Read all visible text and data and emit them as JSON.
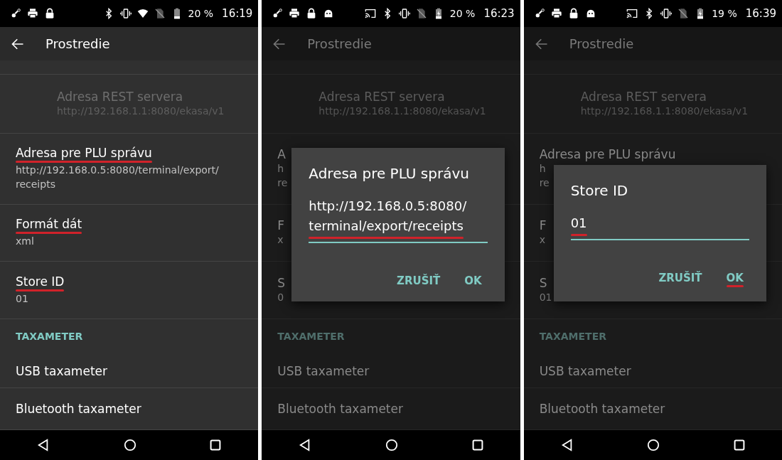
{
  "panels": [
    {
      "status_bar": {
        "left_icons": [
          {
            "kind": "key"
          },
          {
            "kind": "printer"
          },
          {
            "kind": "lock"
          }
        ],
        "right_icons": [
          {
            "kind": "bluetooth"
          },
          {
            "kind": "vibrate"
          },
          {
            "kind": "wifi"
          },
          {
            "kind": "no_sim"
          },
          {
            "kind": "battery"
          }
        ],
        "battery": "20 %",
        "time": "16:19"
      },
      "title": "Prostredie",
      "items": [
        {
          "kind": "pref",
          "title": "Adresa REST servera",
          "summary": [
            "http://192.168.1.1:8080/ekasa/v1"
          ],
          "disabled": true,
          "marked": false
        },
        {
          "kind": "pref",
          "title": "Adresa pre PLU správu",
          "summary": [
            "http://192.168.0.5:8080/terminal/export/",
            "receipts"
          ],
          "disabled": false,
          "marked": true
        },
        {
          "kind": "pref",
          "title": "Formát dát",
          "summary": [
            "xml"
          ],
          "disabled": false,
          "marked": true
        },
        {
          "kind": "pref",
          "title": "Store ID",
          "summary": [
            "01"
          ],
          "disabled": false,
          "marked": true
        },
        {
          "kind": "category",
          "title": "TAXAMETER"
        },
        {
          "kind": "pref",
          "title": "USB taxameter",
          "disabled": false,
          "marked": false
        },
        {
          "kind": "pref",
          "title": "Bluetooth taxameter",
          "disabled": false,
          "marked": false
        }
      ]
    },
    {
      "status_bar": {
        "left_icons": [
          {
            "kind": "key"
          },
          {
            "kind": "printer"
          },
          {
            "kind": "lock"
          },
          {
            "kind": "android"
          }
        ],
        "right_icons": [
          {
            "kind": "cast"
          },
          {
            "kind": "bluetooth"
          },
          {
            "kind": "vibrate"
          },
          {
            "kind": "no_sim"
          },
          {
            "kind": "charging"
          }
        ],
        "battery": "20 %",
        "time": "16:23"
      },
      "title": "Prostredie",
      "items": [
        {
          "kind": "pref",
          "title": "Adresa REST servera",
          "summary": [
            "http://192.168.1.1:8080/ekasa/v1"
          ],
          "disabled": true,
          "marked": false
        },
        {
          "kind": "pref",
          "title": "A",
          "summary": [
            "h",
            "re"
          ],
          "disabled": false,
          "marked": false
        },
        {
          "kind": "pref",
          "title": "F",
          "summary": [
            "x"
          ],
          "disabled": false,
          "marked": false
        },
        {
          "kind": "pref",
          "title": "S",
          "summary": [
            "0"
          ],
          "disabled": false,
          "marked": false
        },
        {
          "kind": "category",
          "title": "TAXAMETER"
        },
        {
          "kind": "pref",
          "title": "USB taxameter",
          "disabled": false,
          "marked": false
        },
        {
          "kind": "pref",
          "title": "Bluetooth taxameter",
          "disabled": false,
          "marked": false
        }
      ],
      "dialog": {
        "title": "Adresa pre PLU správu",
        "value_lines": [
          "http://192.168.0.5:8080/",
          "terminal/export/receipts"
        ],
        "value_marked": true,
        "buttons": [
          {
            "label": "ZRUŠIŤ",
            "marked": false
          },
          {
            "label": "OK",
            "marked": false
          }
        ]
      }
    },
    {
      "status_bar": {
        "left_icons": [
          {
            "kind": "key"
          },
          {
            "kind": "printer"
          },
          {
            "kind": "lock"
          },
          {
            "kind": "android"
          }
        ],
        "right_icons": [
          {
            "kind": "cast"
          },
          {
            "kind": "bluetooth"
          },
          {
            "kind": "vibrate"
          },
          {
            "kind": "no_sim"
          },
          {
            "kind": "charging"
          }
        ],
        "battery": "19 %",
        "time": "16:39"
      },
      "title": "Prostredie",
      "items": [
        {
          "kind": "pref",
          "title": "Adresa REST servera",
          "summary": [
            "http://192.168.1.1:8080/ekasa/v1"
          ],
          "disabled": true,
          "marked": false
        },
        {
          "kind": "pref",
          "title": "Adresa pre PLU správu",
          "summary": [
            "h",
            "re"
          ],
          "disabled": false,
          "marked": false
        },
        {
          "kind": "pref",
          "title": "F",
          "summary": [
            "x"
          ],
          "disabled": false,
          "marked": false
        },
        {
          "kind": "pref",
          "title": "S",
          "summary": [
            "01"
          ],
          "disabled": false,
          "marked": false
        },
        {
          "kind": "category",
          "title": "TAXAMETER"
        },
        {
          "kind": "pref",
          "title": "USB taxameter",
          "disabled": false,
          "marked": false
        },
        {
          "kind": "pref",
          "title": "Bluetooth taxameter",
          "disabled": false,
          "marked": false
        }
      ],
      "dialog": {
        "title": "Store ID",
        "value_lines": [
          "01"
        ],
        "value_marked": true,
        "buttons": [
          {
            "label": "ZRUŠIŤ",
            "marked": false
          },
          {
            "label": "OK",
            "marked": true
          }
        ]
      }
    }
  ]
}
